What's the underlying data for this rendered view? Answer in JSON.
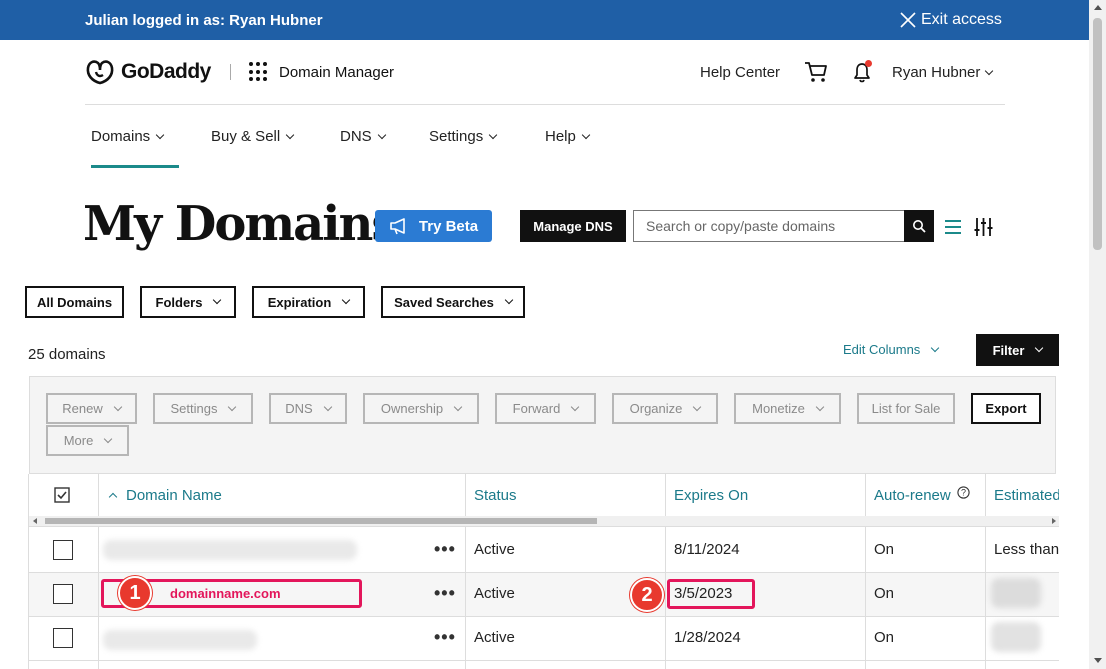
{
  "banner": {
    "impersonation": "Julian logged in as: Ryan Hubner",
    "exit_label": "Exit access"
  },
  "header": {
    "brand": "GoDaddy",
    "app_name": "Domain Manager",
    "help_center": "Help Center",
    "user_name": "Ryan Hubner",
    "notification_dot_color": "#e8392e"
  },
  "nav": {
    "items": [
      "Domains",
      "Buy & Sell",
      "DNS",
      "Settings",
      "Help"
    ],
    "active": "Domains",
    "accent": "#1b8a8a"
  },
  "page": {
    "title": "My Domains",
    "try_beta": "Try Beta",
    "manage_dns": "Manage DNS",
    "search_placeholder": "Search or copy/paste domains"
  },
  "filters": [
    "All Domains",
    "Folders",
    "Expiration",
    "Saved Searches"
  ],
  "summary": {
    "count": "25 domains",
    "edit_columns": "Edit Columns",
    "filter": "Filter"
  },
  "bulk_actions": {
    "buttons": [
      "Renew",
      "Settings",
      "DNS",
      "Ownership",
      "Forward",
      "Organize",
      "Monetize",
      "List for Sale"
    ],
    "export": "Export",
    "more": "More"
  },
  "table": {
    "columns": [
      "Domain Name",
      "Status",
      "Expires On",
      "Auto-renew",
      "Estimated"
    ],
    "rows": [
      {
        "domain": "",
        "status": "Active",
        "expires": "8/11/2024",
        "autorenew": "On",
        "estimated": "Less than"
      },
      {
        "domain": "domainname.com",
        "status": "Active",
        "expires": "3/5/2023",
        "autorenew": "On",
        "estimated": ""
      },
      {
        "domain": "",
        "status": "Active",
        "expires": "1/28/2024",
        "autorenew": "On",
        "estimated": ""
      }
    ]
  },
  "annotations": {
    "badge1": "1",
    "badge2": "2",
    "highlight_color": "#e3165b"
  }
}
